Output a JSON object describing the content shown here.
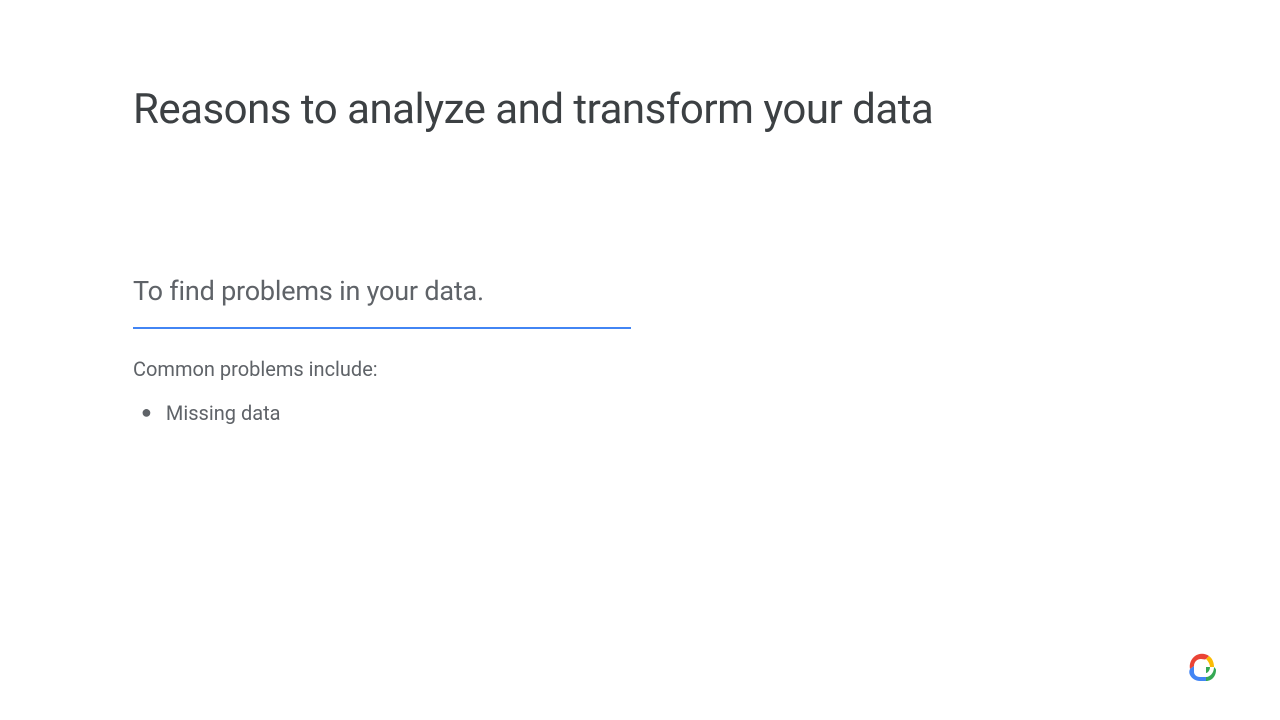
{
  "slide": {
    "title": "Reasons to analyze and transform your data",
    "subtitle": "To find problems in your data.",
    "list_heading": "Common problems include:",
    "bullets": [
      "Missing data"
    ]
  }
}
